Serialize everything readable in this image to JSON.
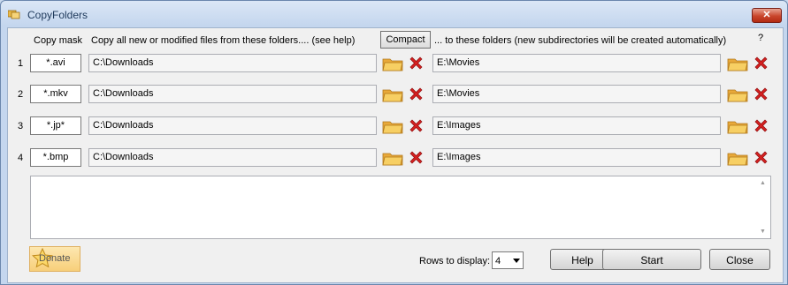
{
  "window": {
    "title": "CopyFolders",
    "close_glyph": "✕"
  },
  "headers": {
    "copy_mask": "Copy mask",
    "source": "Copy all new or modified files from these folders.... (see help)",
    "compact": "Compact",
    "destination": "... to these folders (new subdirectories will be created automatically)",
    "help_q": "?"
  },
  "rows": [
    {
      "num": "1",
      "mask": "*.avi",
      "source": "C:\\Downloads",
      "dest": "E:\\Movies"
    },
    {
      "num": "2",
      "mask": "*.mkv",
      "source": "C:\\Downloads",
      "dest": "E:\\Movies"
    },
    {
      "num": "3",
      "mask": "*.jp*",
      "source": "C:\\Downloads",
      "dest": "E:\\Images"
    },
    {
      "num": "4",
      "mask": "*.bmp",
      "source": "C:\\Downloads",
      "dest": "E:\\Images"
    }
  ],
  "footer": {
    "donate": "Donate",
    "rows_label": "Rows to display:",
    "rows_value": "4",
    "help": "Help",
    "start": "Start",
    "close": "Close"
  },
  "icons": {
    "browse": "folder-icon",
    "remove": "red-x-icon",
    "donate": "star-icon"
  },
  "colors": {
    "titlebar": "#c4d6ee",
    "close": "#c9462c",
    "folder": "#f4c34f",
    "remove": "#d42020"
  }
}
